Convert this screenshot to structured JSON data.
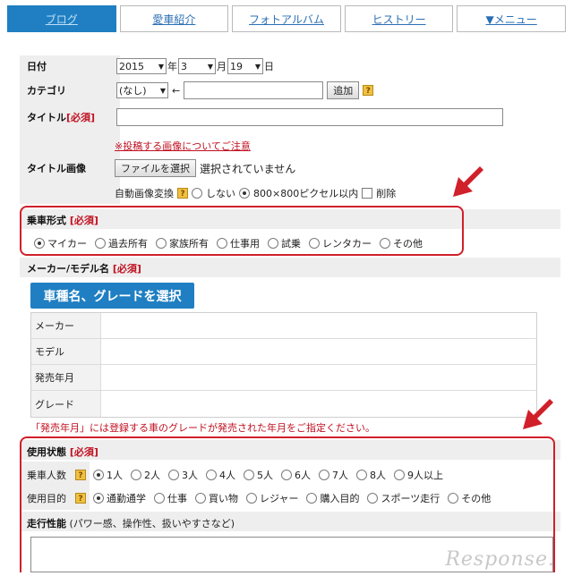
{
  "nav": {
    "tabs": [
      {
        "label": "ブログ",
        "active": true
      },
      {
        "label": "愛車紹介",
        "active": false
      },
      {
        "label": "フォトアルバム",
        "active": false
      },
      {
        "label": "ヒストリー",
        "active": false
      },
      {
        "label": "▼メニュー",
        "active": false
      }
    ]
  },
  "date": {
    "label": "日付",
    "year": "2015",
    "year_unit": "年",
    "month": "3",
    "month_unit": "月",
    "day": "19",
    "day_unit": "日"
  },
  "category": {
    "label": "カテゴリ",
    "selected": "(なし)",
    "arrow_text": "←",
    "add_button": "追加",
    "help": "?"
  },
  "title": {
    "label": "タイトル",
    "required": "[必須]"
  },
  "title_image": {
    "label": "タイトル画像",
    "notice_link": "※投稿する画像についてご注意",
    "file_button": "ファイルを選択",
    "file_status": "選択されていません",
    "auto_convert_label": "自動画像変換",
    "help": "?",
    "option_none": "しない",
    "option_size": "800×800ピクセル以内",
    "delete_label": "削除"
  },
  "ride_type": {
    "label": "乗車形式",
    "required": "[必須]",
    "options": [
      "マイカー",
      "過去所有",
      "家族所有",
      "仕事用",
      "試乗",
      "レンタカー",
      "その他"
    ],
    "selected_index": 0
  },
  "maker_model": {
    "label": "メーカー/モデル名",
    "required": "[必須]",
    "select_button": "車種名、グレードを選択",
    "rows": [
      "メーカー",
      "モデル",
      "発売年月",
      "グレード"
    ],
    "note": "「発売年月」には登録する車のグレードが発売された年月をご指定ください。"
  },
  "usage": {
    "label": "使用状態",
    "required": "[必須]",
    "passengers_label": "乗車人数",
    "passengers_options": [
      "1人",
      "2人",
      "3人",
      "4人",
      "5人",
      "6人",
      "7人",
      "8人",
      "9人以上"
    ],
    "passengers_selected": 0,
    "purpose_label": "使用目的",
    "purpose_options": [
      "通勤通学",
      "仕事",
      "買い物",
      "レジャー",
      "購入目的",
      "スポーツ走行",
      "その他"
    ],
    "purpose_selected": 0,
    "help": "?"
  },
  "performance": {
    "label": "走行性能",
    "hint": "(パワー感、操作性、扱いやすさなど)"
  },
  "watermark": "Response.",
  "colors": {
    "accent": "#1f7fc2",
    "required": "#c01020",
    "highlight": "#d0202a"
  }
}
